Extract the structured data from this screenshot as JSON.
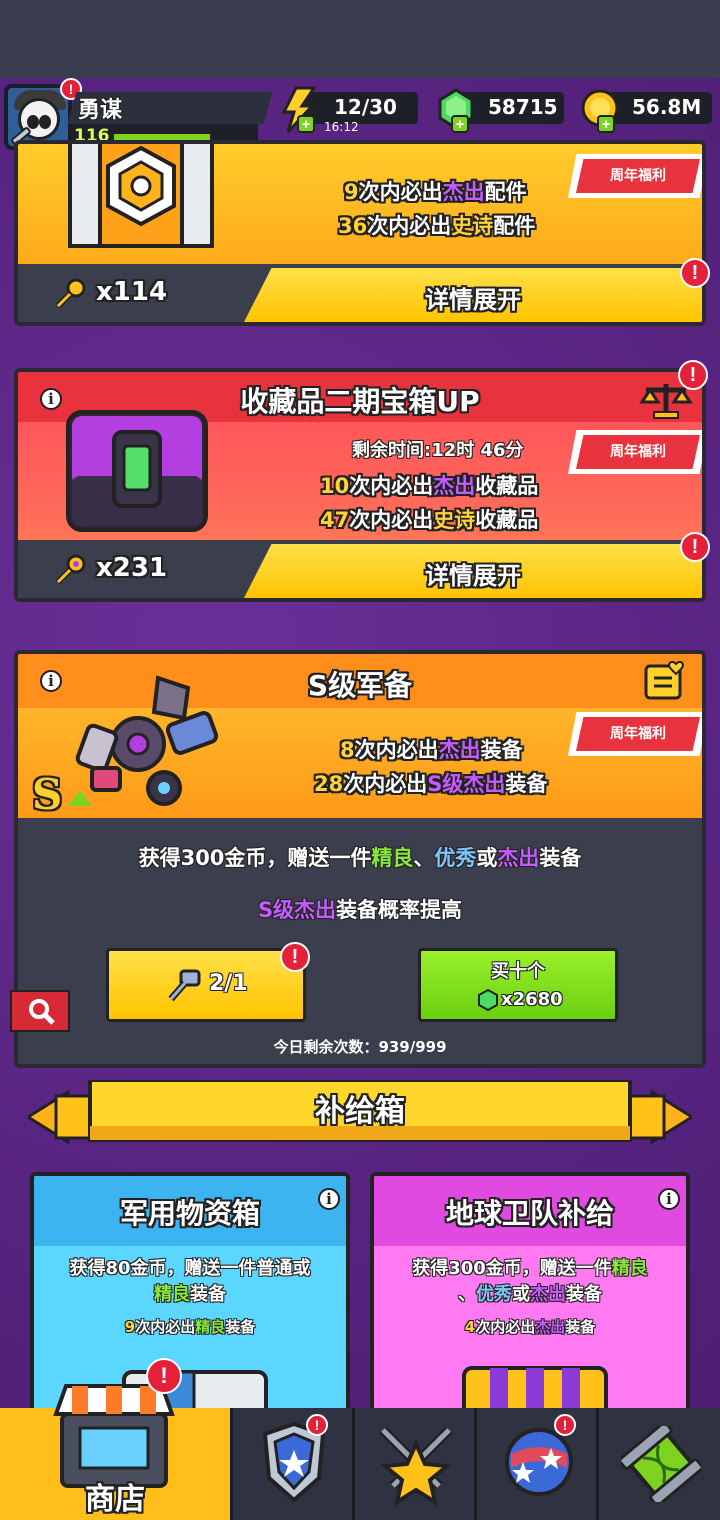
{
  "header": {
    "player_name": "勇谋",
    "level": "116",
    "energy": "12/30",
    "energy_timer": "16:12",
    "gems": "58715",
    "coins": "56.8M"
  },
  "card1": {
    "line1_num": "9",
    "line1_mid": "次内必出",
    "line1_rarity": "杰出",
    "line1_item": "配件",
    "line2_num": "36",
    "line2_mid": "次内必出",
    "line2_rarity": "史诗",
    "line2_item": "配件",
    "tag": "周年福利",
    "keys": "x114",
    "details": "详情展开"
  },
  "card2": {
    "title": "收藏品二期宝箱UP",
    "timer": "剩余时间:12时 46分",
    "line1_num": "10",
    "line1_mid": "次内必出",
    "line1_rarity": "杰出",
    "line1_item": "收藏品",
    "line2_num": "47",
    "line2_mid": "次内必出",
    "line2_rarity": "史诗",
    "line2_item": "收藏品",
    "tag": "周年福利",
    "keys": "x231",
    "details": "详情展开"
  },
  "card3": {
    "title": "S级军备",
    "line1_num": "8",
    "line1_mid": "次内必出",
    "line1_rarity": "杰出",
    "line1_item": "装备",
    "line2_num": "28",
    "line2_mid": "次内必出",
    "line2_rarity": "S级杰出",
    "line2_item": "装备",
    "tag": "周年福利",
    "desc1_a": "获得300金币，赠送一件",
    "desc1_b": "精良",
    "desc1_c": "、",
    "desc1_d": "优秀",
    "desc1_e": "或",
    "desc1_f": "杰出",
    "desc1_g": "装备",
    "desc2_a": "S级杰出",
    "desc2_b": "装备概率提高",
    "key_btn": "2/1",
    "buy_label": "买十个",
    "buy_price": "x2680",
    "remaining": "今日剩余次数：939/999"
  },
  "supply": {
    "banner": "补给箱",
    "box1_title": "军用物资箱",
    "box1_desc_a": "获得80金币，赠送一件普通或",
    "box1_desc_b": "精良",
    "box1_desc_c": "装备",
    "box1_guar_num": "9",
    "box1_guar_mid": "次内必出",
    "box1_guar_rarity": "精良",
    "box1_guar_item": "装备",
    "box2_title": "地球卫队补给",
    "box2_desc_a": "获得300金币，赠送一件",
    "box2_desc_b": "精良",
    "box2_desc_c": "、",
    "box2_desc_d": "优秀",
    "box2_desc_e": "或",
    "box2_desc_f": "杰出",
    "box2_desc_g": "装备",
    "box2_guar_num": "4",
    "box2_guar_mid": "次内必出",
    "box2_guar_rarity": "杰出",
    "box2_guar_item": "装备"
  },
  "badge": "!",
  "info": "i",
  "nav": {
    "shop": "商店"
  },
  "icons": [
    "avatar",
    "energy-bolt-icon",
    "gem-icon",
    "coin-icon",
    "key-icon",
    "info-icon",
    "scales-icon",
    "list-heart-icon",
    "search-icon",
    "shop-icon",
    "badge-icon",
    "crossed-swords-star-icon",
    "planet-icon",
    "dna-canister-icon"
  ]
}
